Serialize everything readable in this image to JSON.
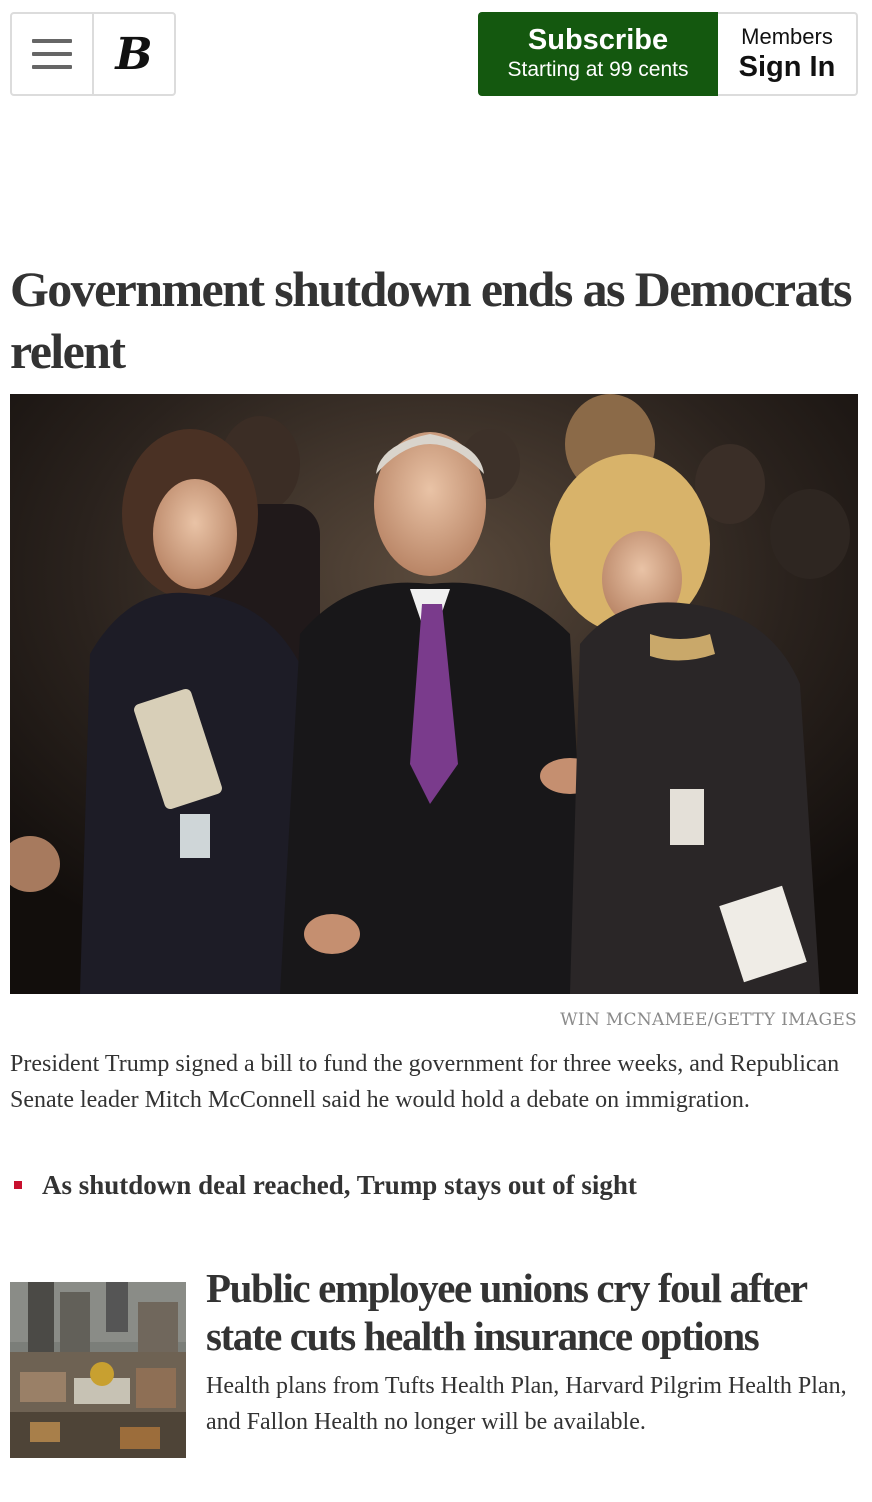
{
  "header": {
    "menu_icon": "hamburger-menu-icon",
    "logo_text": "B",
    "subscribe": {
      "title": "Subscribe",
      "subtitle": "Starting at 99 cents",
      "color": "#14580f"
    },
    "signin": {
      "top": "Members",
      "main": "Sign In"
    }
  },
  "lead_story": {
    "headline": "Government shutdown ends as Democrats relent",
    "photo_credit": "WIN MCNAMEE/GETTY IMAGES",
    "summary": "President Trump signed a bill to fund the government for three weeks, and Republican Senate leader Mitch McConnell said he would hold a debate on immigration.",
    "related_link": "As shutdown deal reached, Trump stays out of sight",
    "bullet_color": "#c8102e"
  },
  "second_story": {
    "headline": "Public employee unions cry foul after state cuts health insurance options",
    "summary": "Health plans from Tufts Health Plan, Harvard Pilgrim Health Plan, and Fallon Health no longer will be available."
  }
}
